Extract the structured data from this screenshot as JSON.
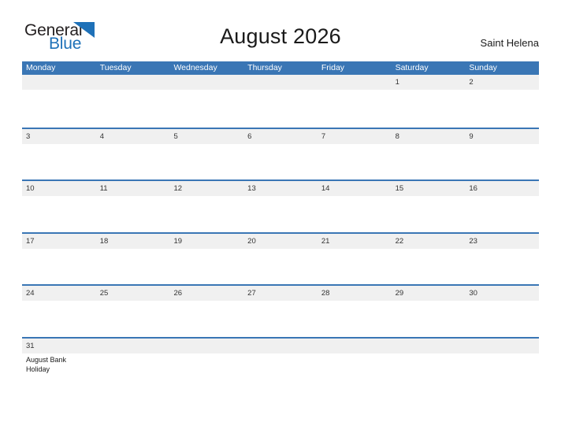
{
  "brand": {
    "name_part1": "General",
    "name_part2": "Blue",
    "flag_icon": "triangle-flag-icon",
    "color_dark": "#231f20",
    "color_blue": "#1e71b8"
  },
  "header": {
    "title": "August 2026",
    "region": "Saint Helena"
  },
  "theme": {
    "header_blue": "#3a76b5",
    "band_gray": "#f0f0f0",
    "text_dark": "#1a1a1a",
    "date_text": "#333333",
    "page_background": "#ffffff"
  },
  "calendar": {
    "weekday_headers": [
      "Monday",
      "Tuesday",
      "Wednesday",
      "Thursday",
      "Friday",
      "Saturday",
      "Sunday"
    ],
    "weeks": [
      {
        "days": [
          {
            "number": "",
            "events": []
          },
          {
            "number": "",
            "events": []
          },
          {
            "number": "",
            "events": []
          },
          {
            "number": "",
            "events": []
          },
          {
            "number": "",
            "events": []
          },
          {
            "number": "1",
            "events": []
          },
          {
            "number": "2",
            "events": []
          }
        ]
      },
      {
        "days": [
          {
            "number": "3",
            "events": []
          },
          {
            "number": "4",
            "events": []
          },
          {
            "number": "5",
            "events": []
          },
          {
            "number": "6",
            "events": []
          },
          {
            "number": "7",
            "events": []
          },
          {
            "number": "8",
            "events": []
          },
          {
            "number": "9",
            "events": []
          }
        ]
      },
      {
        "days": [
          {
            "number": "10",
            "events": []
          },
          {
            "number": "11",
            "events": []
          },
          {
            "number": "12",
            "events": []
          },
          {
            "number": "13",
            "events": []
          },
          {
            "number": "14",
            "events": []
          },
          {
            "number": "15",
            "events": []
          },
          {
            "number": "16",
            "events": []
          }
        ]
      },
      {
        "days": [
          {
            "number": "17",
            "events": []
          },
          {
            "number": "18",
            "events": []
          },
          {
            "number": "19",
            "events": []
          },
          {
            "number": "20",
            "events": []
          },
          {
            "number": "21",
            "events": []
          },
          {
            "number": "22",
            "events": []
          },
          {
            "number": "23",
            "events": []
          }
        ]
      },
      {
        "days": [
          {
            "number": "24",
            "events": []
          },
          {
            "number": "25",
            "events": []
          },
          {
            "number": "26",
            "events": []
          },
          {
            "number": "27",
            "events": []
          },
          {
            "number": "28",
            "events": []
          },
          {
            "number": "29",
            "events": []
          },
          {
            "number": "30",
            "events": []
          }
        ]
      },
      {
        "days": [
          {
            "number": "31",
            "events": [
              "August Bank Holiday"
            ]
          },
          {
            "number": "",
            "events": []
          },
          {
            "number": "",
            "events": []
          },
          {
            "number": "",
            "events": []
          },
          {
            "number": "",
            "events": []
          },
          {
            "number": "",
            "events": []
          },
          {
            "number": "",
            "events": []
          }
        ]
      }
    ]
  }
}
